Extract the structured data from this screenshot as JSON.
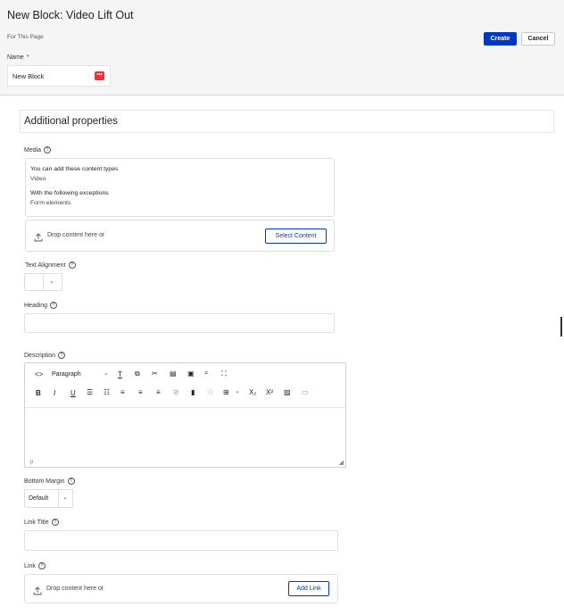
{
  "header": {
    "title": "New Block: Video Lift Out",
    "subtitle": "For This Page",
    "create_label": "Create",
    "cancel_label": "Cancel",
    "name_label": "Name",
    "required_mark": "*",
    "name_value": "New Block",
    "name_badge": "•••"
  },
  "panel": {
    "title": "Additional properties"
  },
  "media": {
    "label": "Media",
    "add_types_heading": "You can add these content types",
    "add_types_value": "Video",
    "exceptions_heading": "With the following exceptions",
    "exceptions_value": "Form elements",
    "drop_text": "Drop content here or",
    "select_button": "Select Content"
  },
  "text_alignment": {
    "label": "Text Alignment",
    "value": ""
  },
  "heading_field": {
    "label": "Heading",
    "value": ""
  },
  "description": {
    "label": "Description",
    "paragraph_select": "Paragraph",
    "status_path": "p"
  },
  "bottom_margin": {
    "label": "Bottom Margin",
    "value": "Default"
  },
  "link_title": {
    "label": "Link Title",
    "value": ""
  },
  "link": {
    "label": "Link",
    "drop_text": "Drop content here or",
    "add_button": "Add Link"
  },
  "icons": {
    "help": "help-circle-icon",
    "upload": "upload-icon",
    "chevron": "chevron-down-icon"
  },
  "colors": {
    "primary": "#0037c1",
    "required": "#dd0000",
    "badge": "#e2383b"
  }
}
